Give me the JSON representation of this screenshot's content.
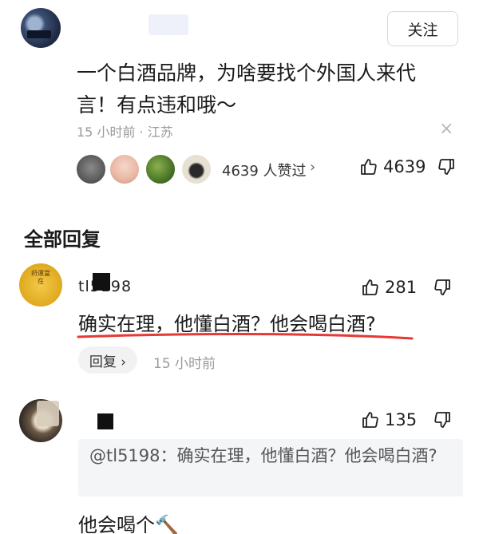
{
  "main_post": {
    "follow_label": "关注",
    "text": "一个白酒品牌，为啥要找个外国人来代言！有点违和哦～",
    "meta": "15 小时前 · 江苏",
    "close_glyph": "×",
    "likers_text": "4639 人赞过",
    "likers_chevron": "›",
    "likes": "4639"
  },
  "section_title": "全部回复",
  "replies": [
    {
      "name": "tl5198",
      "avatar_text": "莳運當在",
      "likes": "281",
      "text": "确实在理，他懂白酒？他会喝白酒?",
      "reply_label": "回复 ›",
      "time": "15 小时前"
    },
    {
      "name": "　",
      "likes": "135",
      "quote": "@tl5198：确实在理，他懂白酒？他会喝白酒?",
      "text": "他会喝个🔨"
    }
  ],
  "colors": {
    "accent_underline": "#e53935",
    "muted_text": "#9a9a9a",
    "reply_button_bg": "#f2f2f2",
    "quote_bg": "#f4f5f7"
  }
}
